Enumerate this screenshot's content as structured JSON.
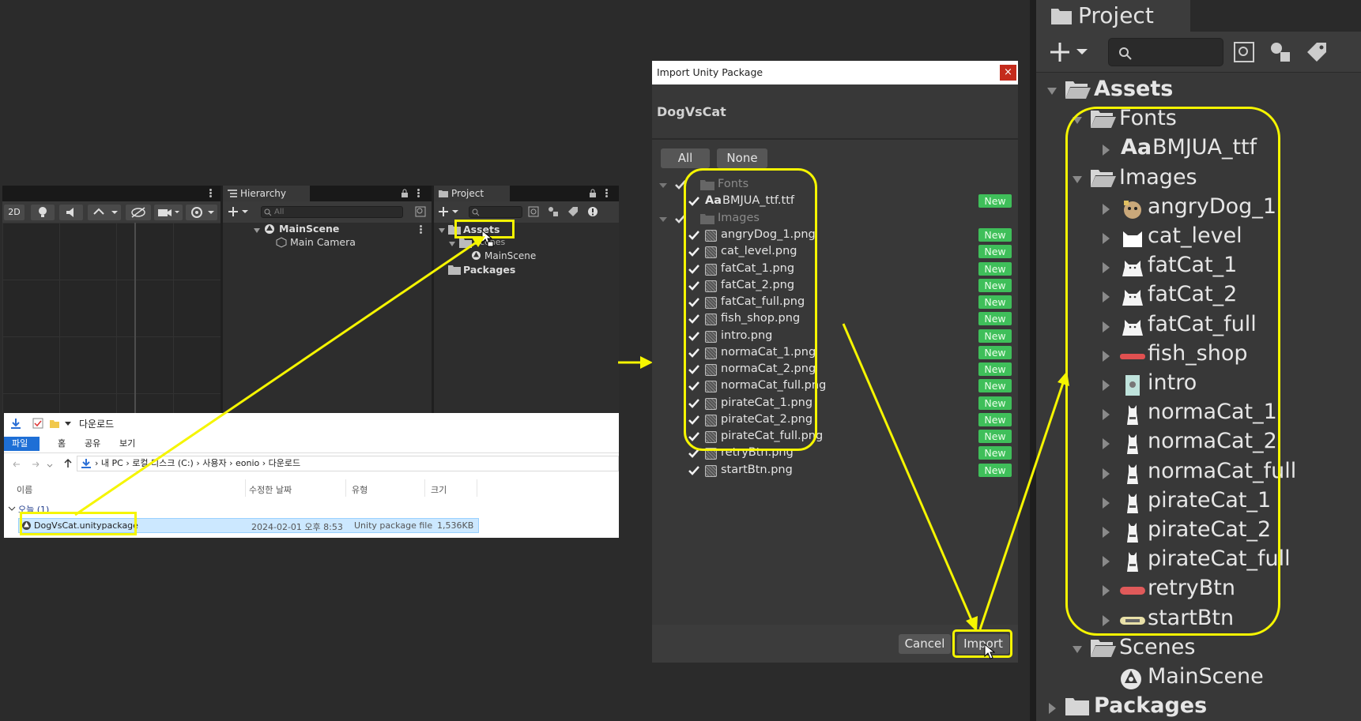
{
  "colors": {
    "highlight": "#f5f500",
    "new_badge": "#3fbf5a",
    "close_button": "#c42b1c",
    "selection": "#cce8ff"
  },
  "editor": {
    "scene_toolbar": {
      "mode_2d": "2D"
    },
    "hierarchy": {
      "tab_label": "Hierarchy",
      "search_placeholder": "All",
      "scene": "MainScene",
      "child": "Main Camera"
    },
    "project_small": {
      "tab_label": "Project",
      "items": {
        "assets": "Assets",
        "scenes": "Scenes",
        "mainscene": "MainScene",
        "packages": "Packages"
      }
    }
  },
  "explorer": {
    "title": "다운로드",
    "ribbon_tabs": [
      "파일",
      "홈",
      "공유",
      "보기"
    ],
    "breadcrumb": [
      "내 PC",
      "로컬 디스크 (C:)",
      "사용자",
      "eonio",
      "다운로드"
    ],
    "columns": {
      "name": "이름",
      "modified": "수정한 날짜",
      "type": "유형",
      "size": "크기"
    },
    "group_label": "오늘 (1)",
    "file": {
      "name": "DogVsCat.unitypackage",
      "modified": "2024-02-01 오후 8:53",
      "type": "Unity package file",
      "size": "1,536KB"
    }
  },
  "import_dialog": {
    "title": "Import Unity Package",
    "package_name": "DogVsCat",
    "buttons": {
      "all": "All",
      "none": "None",
      "cancel": "Cancel",
      "import": "Import"
    },
    "groups": {
      "fonts": "Fonts",
      "images": "Images"
    },
    "new_label": "New",
    "font_file": "BMJUA_ttf.ttf",
    "font_prefix": "Aa",
    "image_files": [
      "angryDog_1.png",
      "cat_level.png",
      "fatCat_1.png",
      "fatCat_2.png",
      "fatCat_full.png",
      "fish_shop.png",
      "intro.png",
      "normaCat_1.png",
      "normaCat_2.png",
      "normaCat_full.png",
      "pirateCat_1.png",
      "pirateCat_2.png",
      "pirateCat_full.png",
      "retryBtn.png",
      "startBtn.png"
    ]
  },
  "project_panel": {
    "tab_label": "Project",
    "assets": "Assets",
    "fonts": "Fonts",
    "font_prefix": "Aa",
    "font_item": "BMJUA_ttf",
    "images": "Images",
    "image_items": [
      "angryDog_1",
      "cat_level",
      "fatCat_1",
      "fatCat_2",
      "fatCat_full",
      "fish_shop",
      "intro",
      "normaCat_1",
      "normaCat_2",
      "normaCat_full",
      "pirateCat_1",
      "pirateCat_2",
      "pirateCat_full",
      "retryBtn",
      "startBtn"
    ],
    "scenes": "Scenes",
    "scene_item": "MainScene",
    "packages": "Packages"
  }
}
